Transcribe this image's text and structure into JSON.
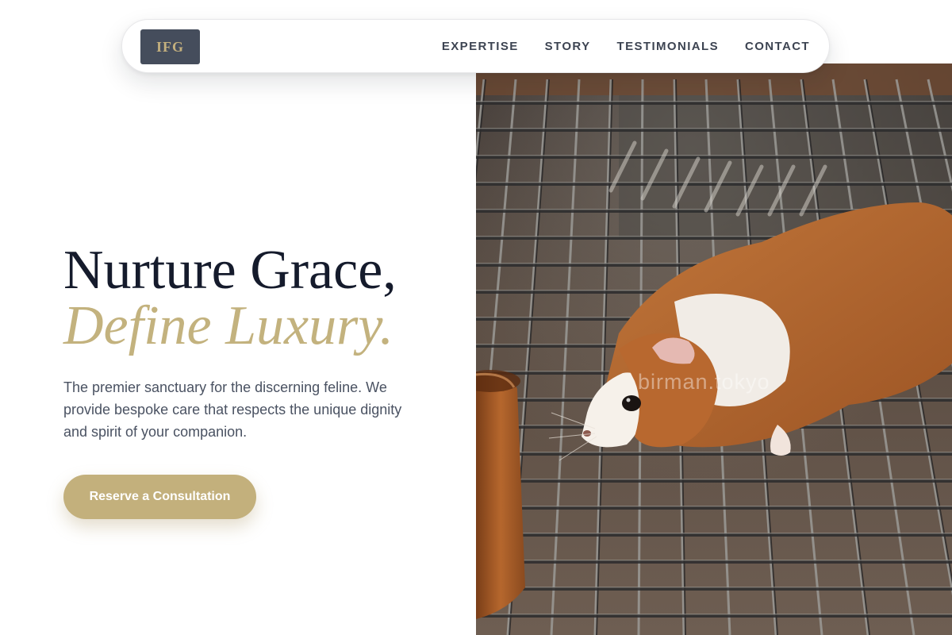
{
  "brand": {
    "logo_text": "IFG",
    "logo_bg": "#454d5c",
    "logo_text_color": "#c4b07e"
  },
  "nav": {
    "links": [
      {
        "label": "EXPERTISE"
      },
      {
        "label": "STORY"
      },
      {
        "label": "TESTIMONIALS"
      },
      {
        "label": "CONTACT"
      }
    ]
  },
  "hero": {
    "headline_line1": "Nurture Grace,",
    "headline_line2": "Define Luxury.",
    "description": "The premier sanctuary for the discerning feline. We provide bespoke care that respects the unique dignity and spirit of your companion.",
    "cta_label": "Reserve a Consultation",
    "image_alt": "Guinea pig walking on a wire cage grate",
    "watermark": "birman.tokyo"
  },
  "colors": {
    "accent_gold": "#c3b27e",
    "headline_navy": "#151b2c",
    "body_text": "#4a5262",
    "nav_text": "#3d4452"
  }
}
